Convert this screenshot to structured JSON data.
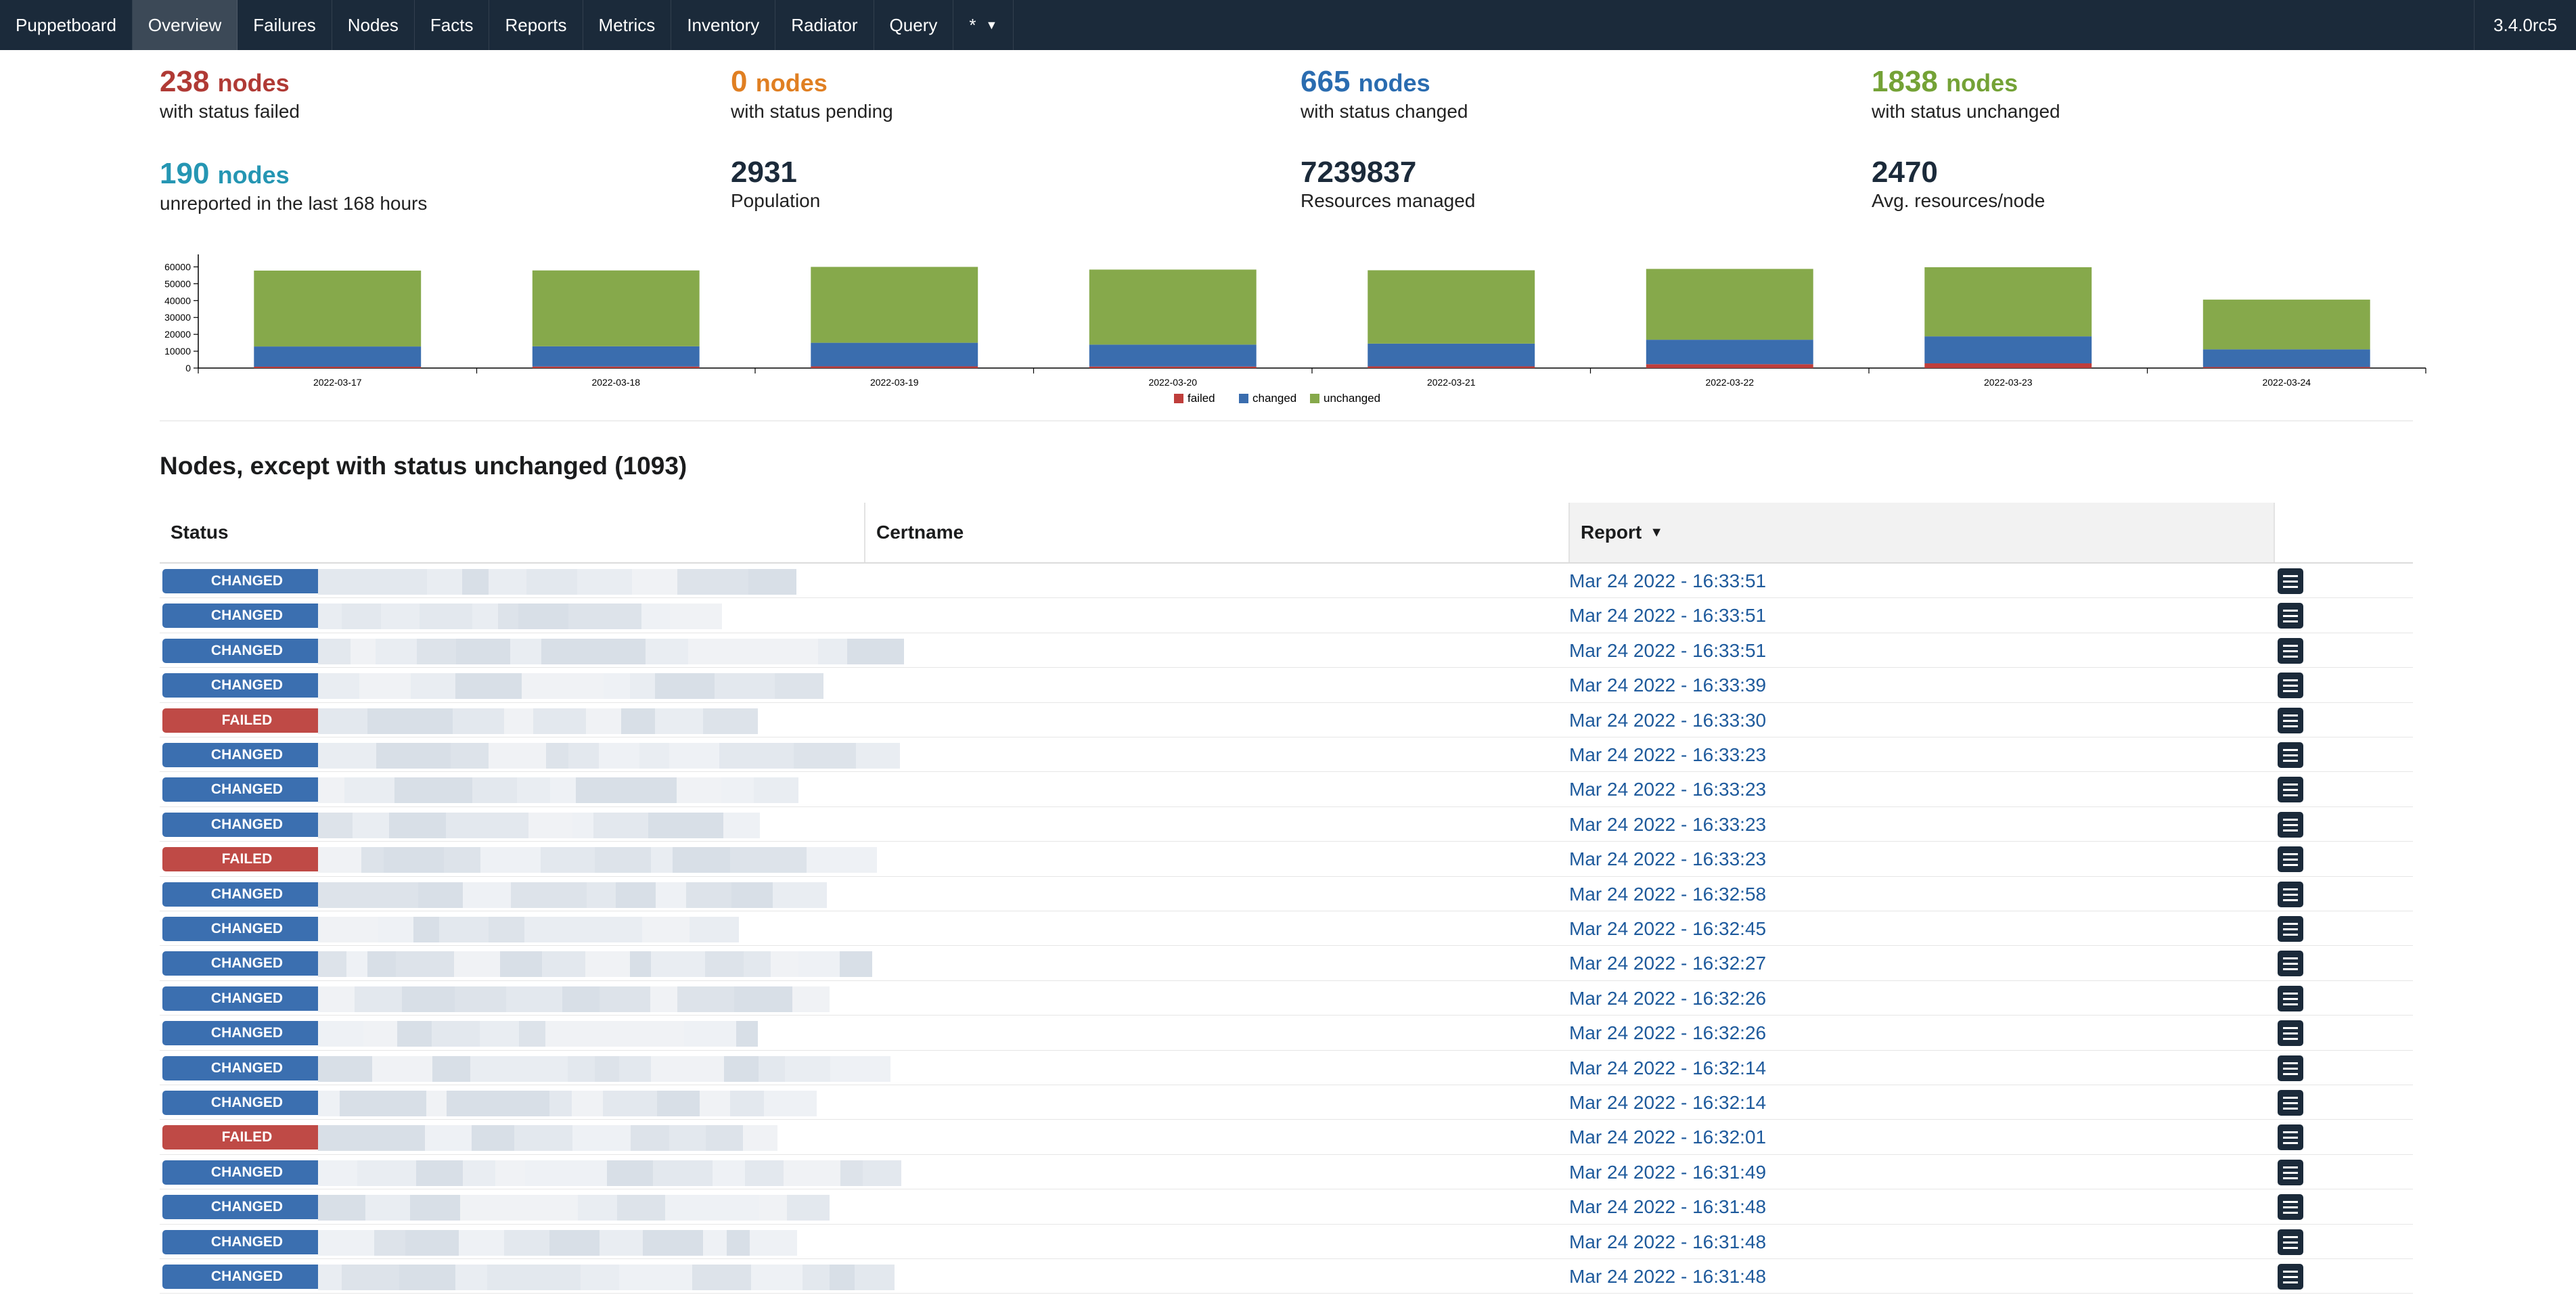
{
  "nav": {
    "brand": "Puppetboard",
    "items": [
      "Overview",
      "Failures",
      "Nodes",
      "Facts",
      "Reports",
      "Metrics",
      "Inventory",
      "Radiator",
      "Query"
    ],
    "active": "Overview",
    "env_selector": "*",
    "version": "3.4.0rc5"
  },
  "stats": {
    "failed": {
      "count": "238",
      "unit": "nodes",
      "label": "with status failed",
      "color": "#b03a35"
    },
    "pending": {
      "count": "0",
      "unit": "nodes",
      "label": "with status pending",
      "color": "#e07f22"
    },
    "changed": {
      "count": "665",
      "unit": "nodes",
      "label": "with status changed",
      "color": "#2a6cb0"
    },
    "unchanged": {
      "count": "1838",
      "unit": "nodes",
      "label": "with status unchanged",
      "color": "#74a236"
    },
    "unreported": {
      "count": "190",
      "unit": "nodes",
      "label": "unreported in the last 168 hours",
      "color": "#2596b3"
    },
    "population": {
      "count": "2931",
      "label": "Population"
    },
    "resources": {
      "count": "7239837",
      "label": "Resources managed"
    },
    "avg": {
      "count": "2470",
      "label": "Avg. resources/node"
    }
  },
  "chart_data": {
    "type": "bar",
    "stacked": true,
    "categories": [
      "2022-03-17",
      "2022-03-18",
      "2022-03-19",
      "2022-03-20",
      "2022-03-21",
      "2022-03-22",
      "2022-03-23",
      "2022-03-24"
    ],
    "series": [
      {
        "name": "failed",
        "color": "#bf3e3b",
        "values": [
          800,
          900,
          1000,
          900,
          1000,
          2300,
          2800,
          600
        ]
      },
      {
        "name": "changed",
        "color": "#3a6dae",
        "values": [
          12000,
          12000,
          14000,
          13000,
          13500,
          14500,
          16000,
          10500
        ]
      },
      {
        "name": "unchanged",
        "color": "#86a94b",
        "values": [
          45000,
          45000,
          45000,
          44500,
          43500,
          42000,
          41000,
          29500
        ]
      }
    ],
    "yticks": [
      0,
      10000,
      20000,
      30000,
      40000,
      50000,
      60000
    ],
    "ylim": [
      0,
      65000
    ],
    "legend_position": "bottom",
    "grid": false
  },
  "table": {
    "title": "Nodes, except with status unchanged (1093)",
    "columns": [
      "Status",
      "Certname",
      "Report"
    ],
    "sorted_column": "Report",
    "rows": [
      {
        "status": "CHANGED",
        "failed": "0",
        "changed": "some",
        "noop": "0",
        "skipped": "0",
        "report": "Mar 24 2022 - 16:33:51"
      },
      {
        "status": "CHANGED",
        "failed": "0",
        "changed": "some",
        "noop": "0",
        "skipped": "0",
        "report": "Mar 24 2022 - 16:33:51"
      },
      {
        "status": "CHANGED",
        "failed": "0",
        "changed": "some",
        "noop": "0",
        "skipped": "0",
        "report": "Mar 24 2022 - 16:33:51"
      },
      {
        "status": "CHANGED",
        "failed": "0",
        "changed": "some",
        "noop": "0",
        "skipped": "0",
        "report": "Mar 24 2022 - 16:33:39"
      },
      {
        "status": "FAILED",
        "failed": "some",
        "changed": "0",
        "noop": "0",
        "skipped": "0",
        "report": "Mar 24 2022 - 16:33:30"
      },
      {
        "status": "CHANGED",
        "failed": "0",
        "changed": "some",
        "noop": "0",
        "skipped": "0",
        "report": "Mar 24 2022 - 16:33:23"
      },
      {
        "status": "CHANGED",
        "failed": "0",
        "changed": "some",
        "noop": "0",
        "skipped": "0",
        "report": "Mar 24 2022 - 16:33:23"
      },
      {
        "status": "CHANGED",
        "failed": "0",
        "changed": "some",
        "noop": "0",
        "skipped": "0",
        "report": "Mar 24 2022 - 16:33:23"
      },
      {
        "status": "FAILED",
        "failed": "some",
        "changed": "0",
        "noop": "0",
        "skipped": "0",
        "report": "Mar 24 2022 - 16:33:23"
      },
      {
        "status": "CHANGED",
        "failed": "0",
        "changed": "some",
        "noop": "0",
        "skipped": "0",
        "report": "Mar 24 2022 - 16:32:58"
      },
      {
        "status": "CHANGED",
        "failed": "0",
        "changed": "some",
        "noop": "0",
        "skipped": "0",
        "report": "Mar 24 2022 - 16:32:45"
      },
      {
        "status": "CHANGED",
        "failed": "0",
        "changed": "some",
        "noop": "0",
        "skipped": "0",
        "report": "Mar 24 2022 - 16:32:27"
      },
      {
        "status": "CHANGED",
        "failed": "0",
        "changed": "some",
        "noop": "0",
        "skipped": "0",
        "report": "Mar 24 2022 - 16:32:26"
      },
      {
        "status": "CHANGED",
        "failed": "0",
        "changed": "some",
        "noop": "0",
        "skipped": "0",
        "report": "Mar 24 2022 - 16:32:26"
      },
      {
        "status": "CHANGED",
        "failed": "0",
        "changed": "some",
        "noop": "0",
        "skipped": "0",
        "report": "Mar 24 2022 - 16:32:14"
      },
      {
        "status": "CHANGED",
        "failed": "0",
        "changed": "some",
        "noop": "0",
        "skipped": "0",
        "report": "Mar 24 2022 - 16:32:14"
      },
      {
        "status": "FAILED",
        "failed": "some",
        "changed": "0",
        "noop": "0",
        "skipped": "0",
        "report": "Mar 24 2022 - 16:32:01"
      },
      {
        "status": "CHANGED",
        "failed": "0",
        "changed": "some",
        "noop": "0",
        "skipped": "0",
        "report": "Mar 24 2022 - 16:31:49"
      },
      {
        "status": "CHANGED",
        "failed": "0",
        "changed": "some",
        "noop": "0",
        "skipped": "0",
        "report": "Mar 24 2022 - 16:31:48"
      },
      {
        "status": "CHANGED",
        "failed": "0",
        "changed": "some",
        "noop": "0",
        "skipped": "0",
        "report": "Mar 24 2022 - 16:31:48"
      },
      {
        "status": "CHANGED",
        "failed": "0",
        "changed": "some",
        "noop": "0",
        "skipped": "0",
        "report": "Mar 24 2022 - 16:31:48"
      }
    ],
    "certname_obscured": true,
    "report_icon": "report-list-icon"
  }
}
